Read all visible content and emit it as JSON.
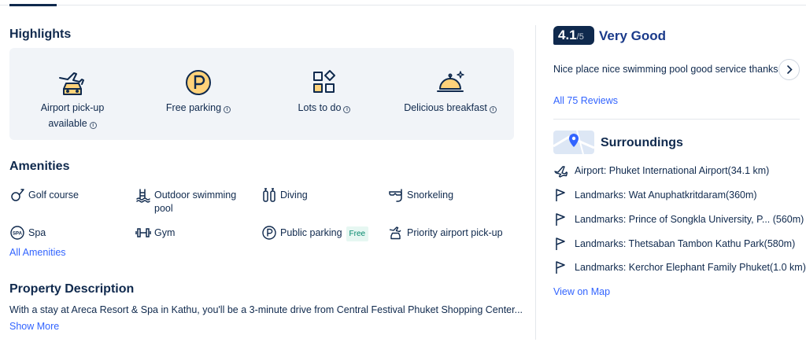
{
  "highlights": {
    "title": "Highlights",
    "items": [
      {
        "label_line1": "Airport pick-up",
        "label_line2": "available",
        "icon": "airport-car-icon"
      },
      {
        "label_line1": "Free parking",
        "label_line2": "",
        "icon": "parking-icon"
      },
      {
        "label_line1": "Lots to do",
        "label_line2": "",
        "icon": "grid-icon"
      },
      {
        "label_line1": "Delicious breakfast",
        "label_line2": "",
        "icon": "cloche-icon"
      }
    ]
  },
  "amenities": {
    "title": "Amenities",
    "items": [
      {
        "label": "Golf course",
        "icon": "golf-icon"
      },
      {
        "label": "Outdoor swimming",
        "label2": "pool",
        "icon": "pool-icon"
      },
      {
        "label": "Diving",
        "icon": "diving-icon"
      },
      {
        "label": "Snorkeling",
        "icon": "snorkel-icon"
      },
      {
        "label": "Spa",
        "icon": "spa-icon",
        "icon_text": "SPA"
      },
      {
        "label": "Gym",
        "icon": "dumbbell-icon"
      },
      {
        "label": "Public parking",
        "badge": "Free",
        "icon": "parking-icon"
      },
      {
        "label": "Priority airport pick-up",
        "icon": "airport-car-icon"
      }
    ],
    "all_link": "All Amenities"
  },
  "description": {
    "title": "Property Description",
    "text": "With a stay at Areca Resort & Spa in Kathu, you'll be a 3-minute drive from Central Festival Phuket Shopping Center...",
    "show_more": "Show More"
  },
  "rating": {
    "score": "4.1",
    "max": "/5",
    "label": "Very Good",
    "review_text": "Nice place nice swimming pool good service thanks",
    "all_reviews": "All 75 Reviews"
  },
  "surroundings": {
    "title": "Surroundings",
    "items": [
      {
        "text": "Airport: Phuket International Airport(34.1 km)",
        "icon": "plane-icon"
      },
      {
        "text": "Landmarks: Wat Anuphatkritdaram(360m)",
        "icon": "flag-icon"
      },
      {
        "text": "Landmarks: Prince of Songkla University, P... (560m)",
        "icon": "flag-icon"
      },
      {
        "text": "Landmarks: Thetsaban Tambon Kathu Park(580m)",
        "icon": "flag-icon"
      },
      {
        "text": "Landmarks: Kerchor Elephant Family Phuket(1.0 km)",
        "icon": "flag-icon"
      }
    ],
    "view_map": "View on Map"
  },
  "colors": {
    "text": "#0f294d",
    "link": "#3264ff",
    "accent": "#ffd27a",
    "highlight_bg": "#f1f4f8"
  }
}
